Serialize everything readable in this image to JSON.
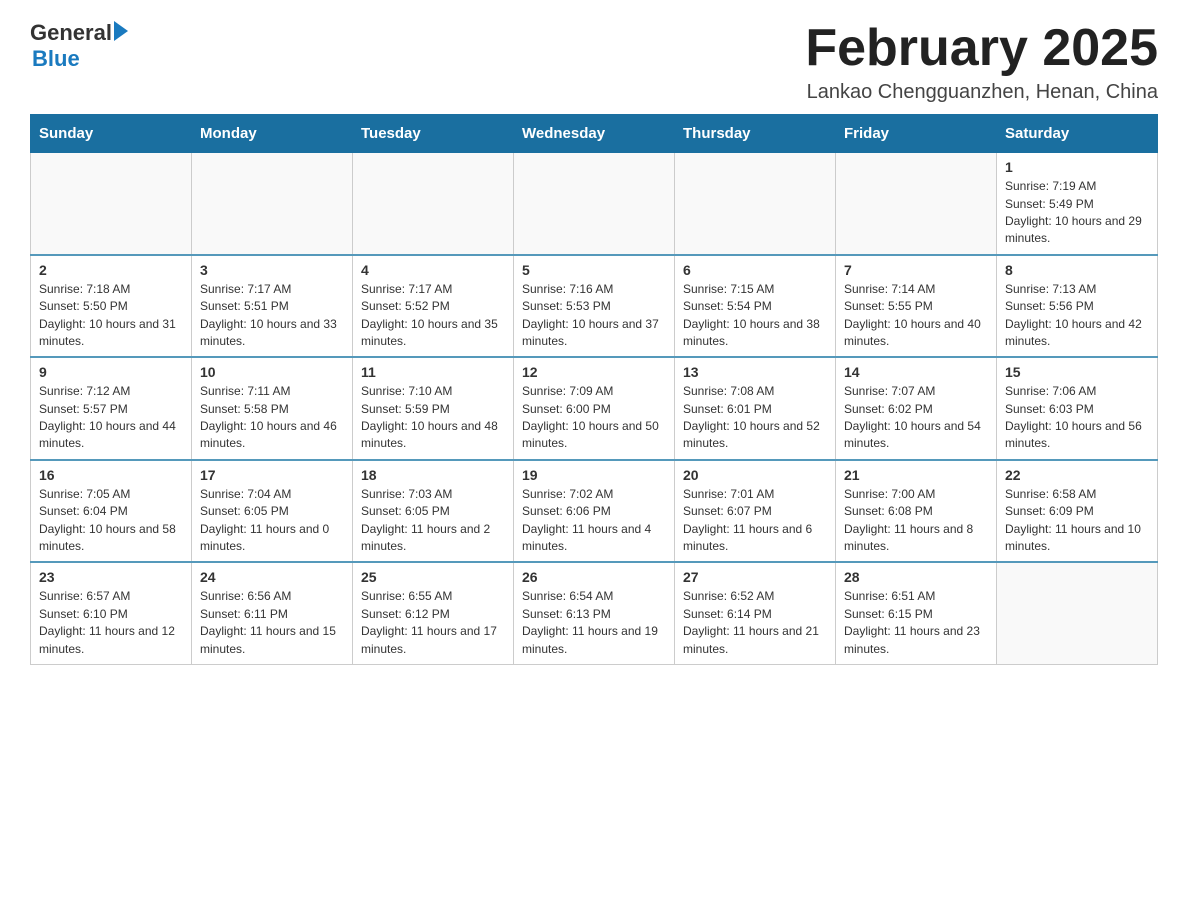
{
  "header": {
    "logo_general": "General",
    "logo_blue": "Blue",
    "month_title": "February 2025",
    "subtitle": "Lankao Chengguanzhen, Henan, China"
  },
  "days_of_week": [
    "Sunday",
    "Monday",
    "Tuesday",
    "Wednesday",
    "Thursday",
    "Friday",
    "Saturday"
  ],
  "weeks": [
    {
      "cells": [
        {
          "day": null,
          "info": null
        },
        {
          "day": null,
          "info": null
        },
        {
          "day": null,
          "info": null
        },
        {
          "day": null,
          "info": null
        },
        {
          "day": null,
          "info": null
        },
        {
          "day": null,
          "info": null
        },
        {
          "day": "1",
          "info": "Sunrise: 7:19 AM\nSunset: 5:49 PM\nDaylight: 10 hours and 29 minutes."
        }
      ]
    },
    {
      "cells": [
        {
          "day": "2",
          "info": "Sunrise: 7:18 AM\nSunset: 5:50 PM\nDaylight: 10 hours and 31 minutes."
        },
        {
          "day": "3",
          "info": "Sunrise: 7:17 AM\nSunset: 5:51 PM\nDaylight: 10 hours and 33 minutes."
        },
        {
          "day": "4",
          "info": "Sunrise: 7:17 AM\nSunset: 5:52 PM\nDaylight: 10 hours and 35 minutes."
        },
        {
          "day": "5",
          "info": "Sunrise: 7:16 AM\nSunset: 5:53 PM\nDaylight: 10 hours and 37 minutes."
        },
        {
          "day": "6",
          "info": "Sunrise: 7:15 AM\nSunset: 5:54 PM\nDaylight: 10 hours and 38 minutes."
        },
        {
          "day": "7",
          "info": "Sunrise: 7:14 AM\nSunset: 5:55 PM\nDaylight: 10 hours and 40 minutes."
        },
        {
          "day": "8",
          "info": "Sunrise: 7:13 AM\nSunset: 5:56 PM\nDaylight: 10 hours and 42 minutes."
        }
      ]
    },
    {
      "cells": [
        {
          "day": "9",
          "info": "Sunrise: 7:12 AM\nSunset: 5:57 PM\nDaylight: 10 hours and 44 minutes."
        },
        {
          "day": "10",
          "info": "Sunrise: 7:11 AM\nSunset: 5:58 PM\nDaylight: 10 hours and 46 minutes."
        },
        {
          "day": "11",
          "info": "Sunrise: 7:10 AM\nSunset: 5:59 PM\nDaylight: 10 hours and 48 minutes."
        },
        {
          "day": "12",
          "info": "Sunrise: 7:09 AM\nSunset: 6:00 PM\nDaylight: 10 hours and 50 minutes."
        },
        {
          "day": "13",
          "info": "Sunrise: 7:08 AM\nSunset: 6:01 PM\nDaylight: 10 hours and 52 minutes."
        },
        {
          "day": "14",
          "info": "Sunrise: 7:07 AM\nSunset: 6:02 PM\nDaylight: 10 hours and 54 minutes."
        },
        {
          "day": "15",
          "info": "Sunrise: 7:06 AM\nSunset: 6:03 PM\nDaylight: 10 hours and 56 minutes."
        }
      ]
    },
    {
      "cells": [
        {
          "day": "16",
          "info": "Sunrise: 7:05 AM\nSunset: 6:04 PM\nDaylight: 10 hours and 58 minutes."
        },
        {
          "day": "17",
          "info": "Sunrise: 7:04 AM\nSunset: 6:05 PM\nDaylight: 11 hours and 0 minutes."
        },
        {
          "day": "18",
          "info": "Sunrise: 7:03 AM\nSunset: 6:05 PM\nDaylight: 11 hours and 2 minutes."
        },
        {
          "day": "19",
          "info": "Sunrise: 7:02 AM\nSunset: 6:06 PM\nDaylight: 11 hours and 4 minutes."
        },
        {
          "day": "20",
          "info": "Sunrise: 7:01 AM\nSunset: 6:07 PM\nDaylight: 11 hours and 6 minutes."
        },
        {
          "day": "21",
          "info": "Sunrise: 7:00 AM\nSunset: 6:08 PM\nDaylight: 11 hours and 8 minutes."
        },
        {
          "day": "22",
          "info": "Sunrise: 6:58 AM\nSunset: 6:09 PM\nDaylight: 11 hours and 10 minutes."
        }
      ]
    },
    {
      "cells": [
        {
          "day": "23",
          "info": "Sunrise: 6:57 AM\nSunset: 6:10 PM\nDaylight: 11 hours and 12 minutes."
        },
        {
          "day": "24",
          "info": "Sunrise: 6:56 AM\nSunset: 6:11 PM\nDaylight: 11 hours and 15 minutes."
        },
        {
          "day": "25",
          "info": "Sunrise: 6:55 AM\nSunset: 6:12 PM\nDaylight: 11 hours and 17 minutes."
        },
        {
          "day": "26",
          "info": "Sunrise: 6:54 AM\nSunset: 6:13 PM\nDaylight: 11 hours and 19 minutes."
        },
        {
          "day": "27",
          "info": "Sunrise: 6:52 AM\nSunset: 6:14 PM\nDaylight: 11 hours and 21 minutes."
        },
        {
          "day": "28",
          "info": "Sunrise: 6:51 AM\nSunset: 6:15 PM\nDaylight: 11 hours and 23 minutes."
        },
        {
          "day": null,
          "info": null
        }
      ]
    }
  ]
}
